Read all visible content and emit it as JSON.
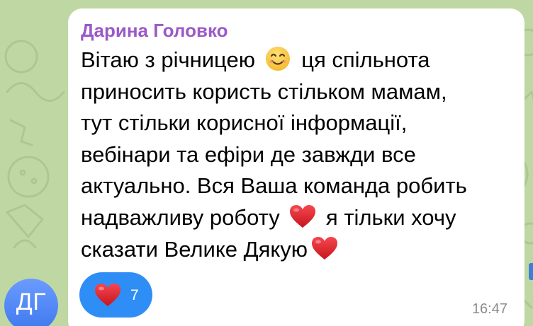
{
  "chat": {
    "sender_name": "Дарина Головко",
    "avatar_initials": "ДГ",
    "message_lines": [
      [
        "Вітаю з річницею ",
        "smile",
        " ця спільнота"
      ],
      [
        "приносить користь стільком мамам,"
      ],
      [
        "тут стільки корисної інформації,"
      ],
      [
        "вебінари та ефіри де завжди все"
      ],
      [
        "актуально. Вся Ваша команда робить"
      ],
      [
        "надважливу роботу ",
        "heart",
        " я тільки хочу"
      ],
      [
        "сказати Велике Дякую",
        "heart"
      ]
    ],
    "reaction": {
      "emoji": "heart-icon",
      "count": "7"
    },
    "time": "16:47"
  },
  "colors": {
    "wallpaper": "#bfd8a3",
    "sender_name": "#9b59c8",
    "reaction_bg": "#2f8df6",
    "avatar": "#4a84f2",
    "heart": "#e3262f"
  }
}
